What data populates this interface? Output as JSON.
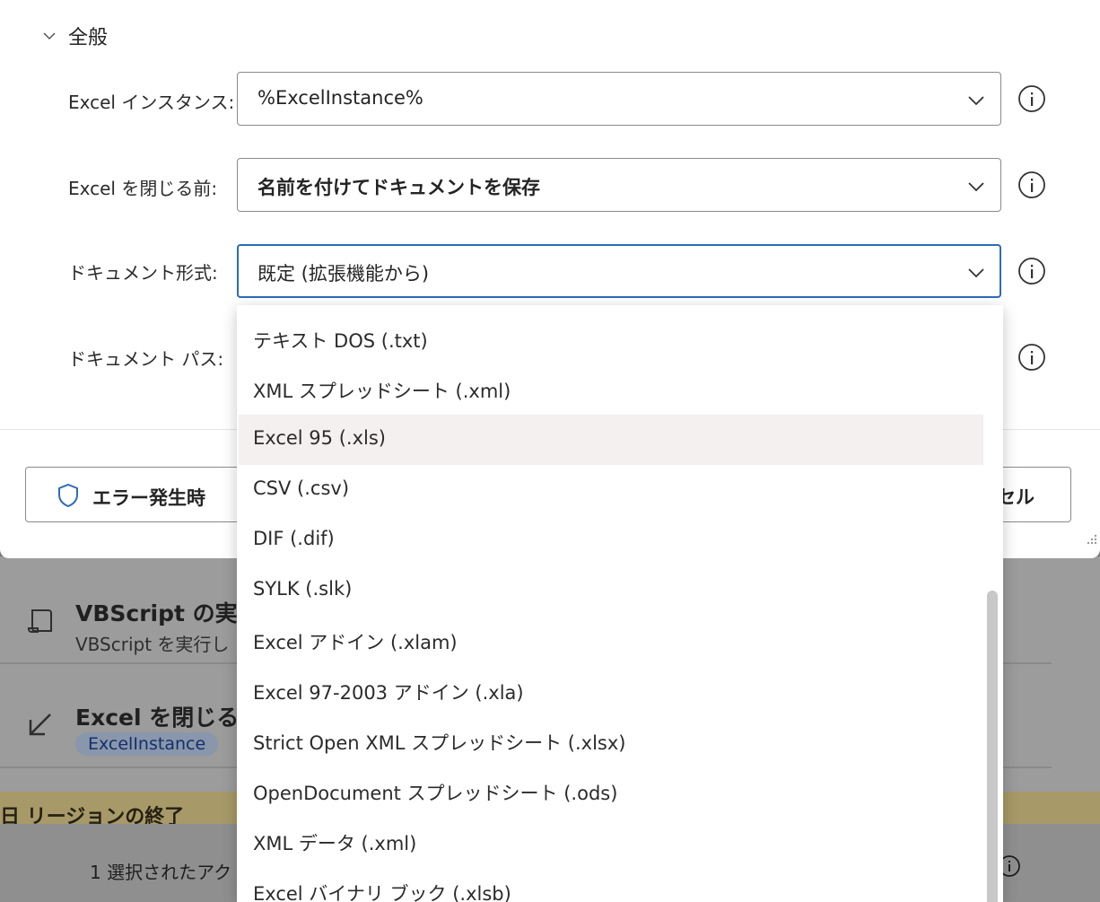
{
  "section": {
    "title": "全般"
  },
  "fields": {
    "instance": {
      "label": "Excel インスタンス:",
      "value": "%ExcelInstance%"
    },
    "before_close": {
      "label": "Excel を閉じる前:",
      "value": "名前を付けてドキュメントを保存"
    },
    "format": {
      "label": "ドキュメント形式:",
      "value": "既定 (拡張機能から)"
    },
    "path": {
      "label": "ドキュメント パス:"
    }
  },
  "buttons": {
    "on_error": "エラー発生時",
    "cancel": "セル"
  },
  "dropdown": {
    "items": [
      "テキスト DOS (.txt)",
      "XML スプレッドシート (.xml)",
      "Excel 95 (.xls)",
      "CSV (.csv)",
      "DIF (.dif)",
      "SYLK (.slk)",
      "Excel アドイン (.xlam)",
      "Excel 97-2003 アドイン (.xla)",
      "Strict Open XML スプレッドシート (.xlsx)",
      "OpenDocument スプレッドシート (.ods)",
      "XML データ (.xml)",
      "Excel バイナリ ブック (.xlsb)"
    ],
    "hovered_item": "Excel 95 (.xls)"
  },
  "background": {
    "action1": {
      "title": "VBScript の実行",
      "subtitle": "VBScript を実行し"
    },
    "action2": {
      "title": "Excel を閉じる",
      "chip": "ExcelInstance"
    },
    "region_label": "日 リージョンの終了",
    "status_text": "1 選択されたアク"
  },
  "colors": {
    "accent": "#2b6cb8",
    "hover": "#f3f0ef",
    "region": "#a79a68"
  }
}
